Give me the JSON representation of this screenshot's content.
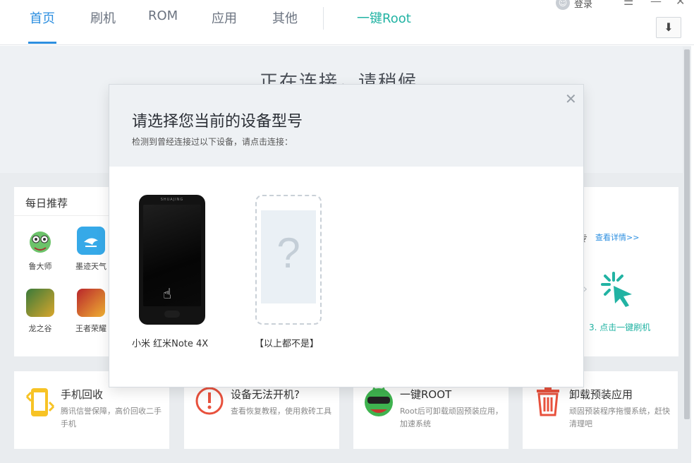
{
  "nav": {
    "tabs": [
      "首页",
      "刷机",
      "ROM",
      "应用",
      "其他"
    ],
    "root_tab": "一键Root",
    "login": "登录",
    "accent": "#2d8fe0",
    "root_color": "#22b3a3"
  },
  "status": {
    "connecting": "正在连接，请稍候"
  },
  "recommend": {
    "title": "每日推荐",
    "apps": [
      "鲁大师",
      "墨迹天气",
      "龙之谷",
      "王者荣耀"
    ]
  },
  "right_card": {
    "partial_text": "专",
    "detail_link": "查看详情>>",
    "step3": "3. 点击一键刷机"
  },
  "tools": [
    {
      "name": "手机回收",
      "desc": "腾讯信誉保障，高价回收二手手机",
      "icon": "phone-recycle-icon"
    },
    {
      "name": "设备无法开机?",
      "desc": "查看恢复教程，使用救砖工具",
      "icon": "warning-icon"
    },
    {
      "name": "一键ROOT",
      "desc": "Root后可卸载顽固预装应用，加速系统",
      "icon": "root-mascot-icon"
    },
    {
      "name": "卸载预装应用",
      "desc": "顽固预装程序拖慢系统，赶快清理吧",
      "icon": "trash-icon"
    }
  ],
  "dialog": {
    "title": "请选择您当前的设备型号",
    "subtitle": "检测到曾经连接过以下设备，请点击连接：",
    "devices": [
      {
        "label": "小米 红米Note 4X",
        "brand_text": "SHUAJING"
      },
      {
        "label": "【以上都不是】",
        "placeholder": "?"
      }
    ]
  }
}
